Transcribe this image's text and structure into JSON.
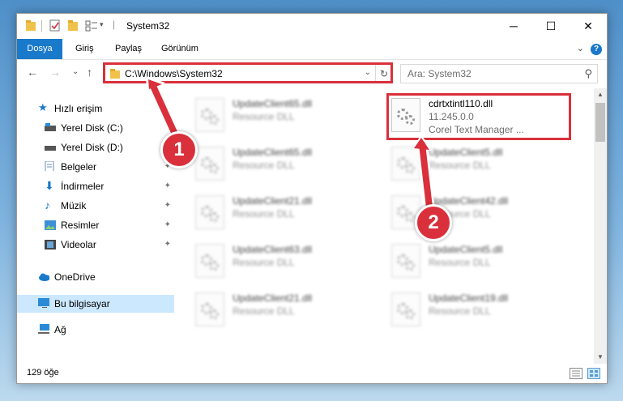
{
  "window": {
    "title": "System32",
    "minimize_glyph": "─",
    "maximize_glyph": "☐",
    "close_glyph": "✕"
  },
  "ribbon": {
    "tabs": [
      "Dosya",
      "Giriş",
      "Paylaş",
      "Görünüm"
    ],
    "active_tab": "Dosya",
    "expand_glyph": "⌄",
    "help_glyph": "?"
  },
  "nav": {
    "back_glyph": "←",
    "forward_glyph": "→",
    "recent_glyph": "⌄",
    "up_glyph": "↑",
    "address": "C:\\Windows\\System32",
    "address_dropdown_glyph": "⌄",
    "refresh_glyph": "↻",
    "search_placeholder": "Ara: System32",
    "search_glyph": "⚲"
  },
  "sidebar": {
    "items": [
      {
        "label": "Hızlı erişim",
        "icon": "star-icon",
        "pinned": false
      },
      {
        "label": "Yerel Disk (C:)",
        "icon": "drive-icon",
        "pinned": false
      },
      {
        "label": "Yerel Disk (D:)",
        "icon": "drive-icon",
        "pinned": false
      },
      {
        "label": "Belgeler",
        "icon": "documents-icon",
        "pinned": true
      },
      {
        "label": "İndirmeler",
        "icon": "download-icon",
        "pinned": true
      },
      {
        "label": "Müzik",
        "icon": "music-icon",
        "pinned": true
      },
      {
        "label": "Resimler",
        "icon": "pictures-icon",
        "pinned": true
      },
      {
        "label": "Videolar",
        "icon": "videos-icon",
        "pinned": true
      },
      {
        "label": "OneDrive",
        "icon": "cloud-icon",
        "pinned": false
      },
      {
        "label": "Bu bilgisayar",
        "icon": "computer-icon",
        "pinned": false,
        "selected": true
      },
      {
        "label": "Ağ",
        "icon": "network-icon",
        "pinned": false
      }
    ],
    "pin_glyph": "📌"
  },
  "files": [
    {
      "name": "UpdateClient65.dll",
      "sub1": "Resource DLL",
      "sub2": "",
      "highlighted": false
    },
    {
      "name": "cdrtxtintl110.dll",
      "sub1": "11.245.0.0",
      "sub2": "Corel Text Manager ...",
      "highlighted": true
    },
    {
      "name": "UpdateClient65.dll",
      "sub1": "Resource DLL",
      "sub2": "",
      "highlighted": false
    },
    {
      "name": "UpdateClient5.dll",
      "sub1": "Resource DLL",
      "sub2": "",
      "highlighted": false
    },
    {
      "name": "UpdateClient21.dll",
      "sub1": "Resource DLL",
      "sub2": "",
      "highlighted": false
    },
    {
      "name": "UpdateClient42.dll",
      "sub1": "Resource DLL",
      "sub2": "",
      "highlighted": false
    },
    {
      "name": "UpdateClient63.dll",
      "sub1": "Resource DLL",
      "sub2": "",
      "highlighted": false
    },
    {
      "name": "UpdateClient5.dll",
      "sub1": "Resource DLL",
      "sub2": "",
      "highlighted": false
    },
    {
      "name": "UpdateClient21.dll",
      "sub1": "Resource DLL",
      "sub2": "",
      "highlighted": false
    },
    {
      "name": "UpdateClient19.dll",
      "sub1": "Resource DLL",
      "sub2": "",
      "highlighted": false
    }
  ],
  "status": {
    "item_count": "129 öğe"
  },
  "scroll": {
    "up_glyph": "▲",
    "down_glyph": "▼"
  },
  "callouts": {
    "step1": "1",
    "step2": "2"
  },
  "colors": {
    "accent": "#1979ca",
    "highlight": "#d9303b",
    "selected_bg": "#cce8ff"
  }
}
